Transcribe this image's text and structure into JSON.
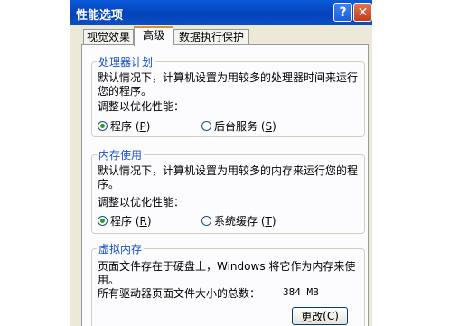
{
  "window": {
    "title": "性能选项",
    "help_label": "?",
    "close_label": "✕"
  },
  "tabs": [
    {
      "label": "视觉效果"
    },
    {
      "label": "高级"
    },
    {
      "label": "数据执行保护"
    }
  ],
  "processor": {
    "title": "处理器计划",
    "desc_line1": "默认情况下，计算机设置为用较多的处理器时间来运行",
    "desc_line2": "您的程序。",
    "adjust_label": "调整以优化性能：",
    "opt1": {
      "label": "程序",
      "key": "P"
    },
    "opt2": {
      "label": "后台服务",
      "key": "S"
    },
    "selected": "程序"
  },
  "memory": {
    "title": "内存使用",
    "desc_line1": "默认情况下，计算机设置为用较多的内存来运行您的程",
    "desc_line2": "序。",
    "adjust_label": "调整以优化性能：",
    "opt1": {
      "label": "程序",
      "key": "R"
    },
    "opt2": {
      "label": "系统缓存",
      "key": "T"
    },
    "selected": "程序"
  },
  "virtual_memory": {
    "title": "虚拟内存",
    "desc": "页面文件存在于硬盘上，Windows 将它作为内存来使用。",
    "total_label": "所有驱动器页面文件大小的总数：",
    "total_value": "384 MB",
    "change_button": {
      "label": "更改",
      "key": "C"
    }
  }
}
